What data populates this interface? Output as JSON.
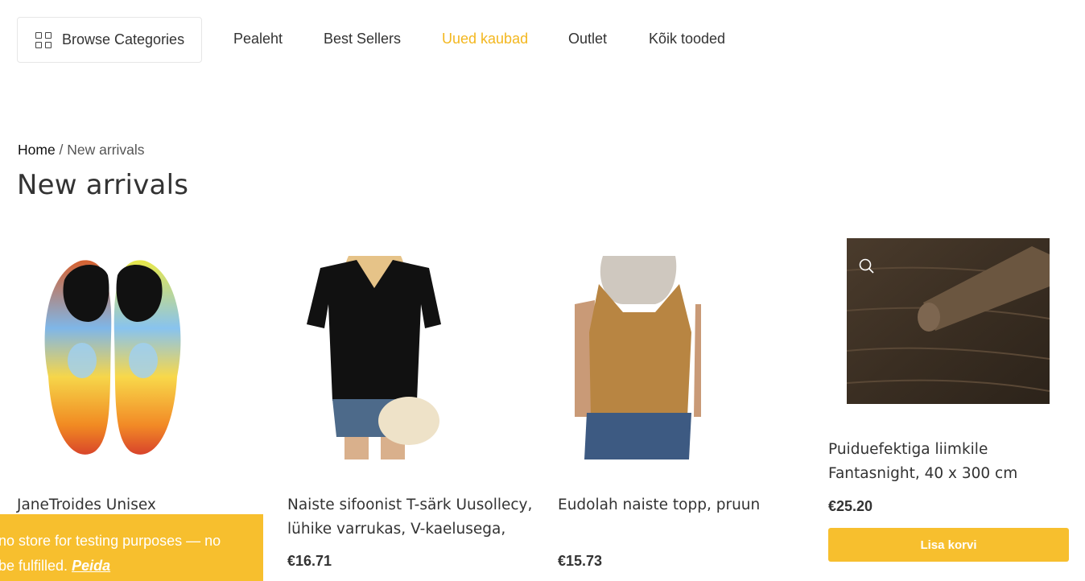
{
  "nav": {
    "browse_label": "Browse Categories",
    "items": [
      {
        "label": "Pealeht",
        "active": false
      },
      {
        "label": "Best Sellers",
        "active": false
      },
      {
        "label": "Uued kaubad",
        "active": true
      },
      {
        "label": "Outlet",
        "active": false
      },
      {
        "label": "Kõik tooded",
        "active": false
      }
    ],
    "active_color": "#f3b71f"
  },
  "breadcrumb": {
    "home": "Home",
    "separator": " / ",
    "current": "New arrivals"
  },
  "page": {
    "title": "New arrivals"
  },
  "products": [
    {
      "name": "JaneTroides Unisex",
      "price": "",
      "image_icon": "water-shoes-image"
    },
    {
      "name": "Naiste sifoonist T-särk Uusollecy, lühike varrukas, V-kaelusega,",
      "price": "€16.71",
      "image_icon": "black-blouse-image"
    },
    {
      "name": "Eudolah naiste topp, pruun",
      "price": "€15.73",
      "image_icon": "brown-tank-top-image"
    },
    {
      "name": "Puiduefektiga liimkile Fantasnight, 40 x 300 cm",
      "price": "€25.20",
      "image_icon": "wood-film-image",
      "button": "Lisa korvi"
    }
  ],
  "notice": {
    "line1": "no store for testing purposes — no",
    "line2": "be fulfilled.",
    "dismiss": "Peida"
  },
  "colors": {
    "accent": "#f7bf2e",
    "text": "#333333"
  }
}
